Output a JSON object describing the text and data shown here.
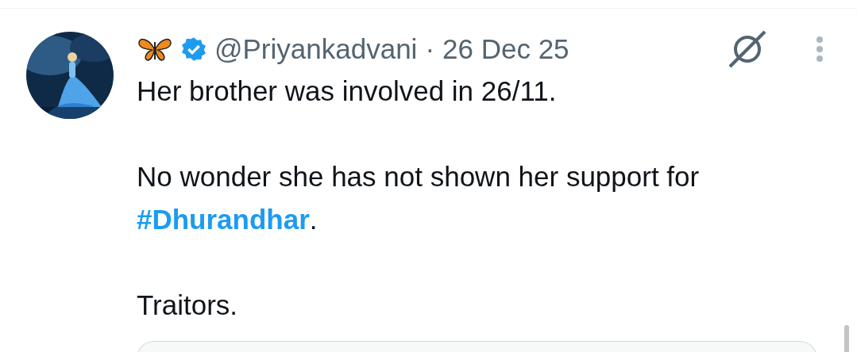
{
  "post": {
    "handle": "@Priyankadvani",
    "separator": "·",
    "date": "26 Dec 25",
    "verified": true,
    "paragraphs": [
      {
        "segments": [
          {
            "kind": "text",
            "text": "Her brother was involved in 26/11."
          }
        ]
      },
      {
        "segments": [
          {
            "kind": "text",
            "text": "No wonder she has not shown her support for "
          },
          {
            "kind": "hashtag",
            "text": "#Dhurandhar"
          },
          {
            "kind": "text",
            "text": "."
          }
        ]
      },
      {
        "segments": [
          {
            "kind": "text",
            "text": "Traitors."
          }
        ]
      }
    ]
  }
}
